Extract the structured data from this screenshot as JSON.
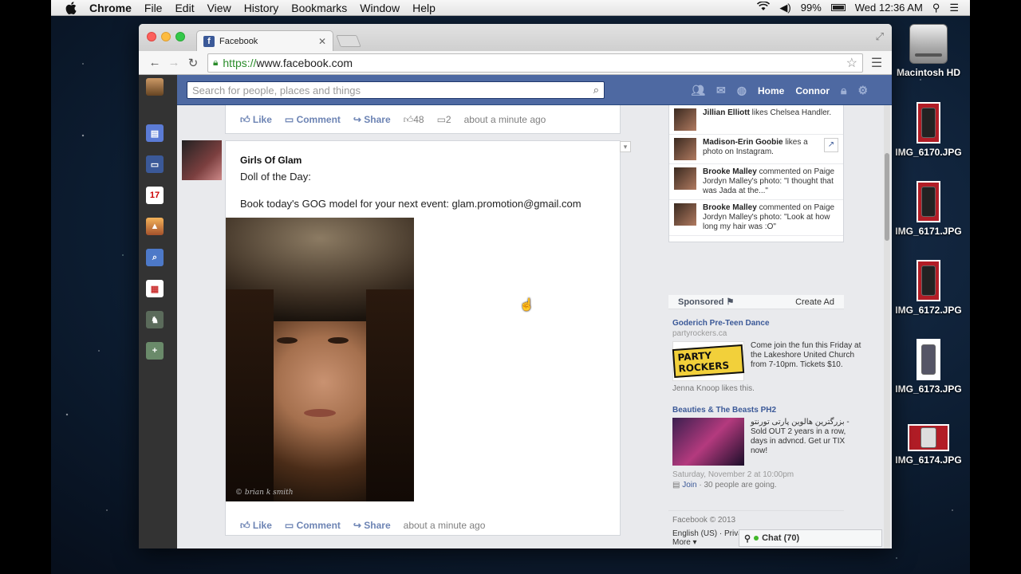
{
  "menubar": {
    "app": "Chrome",
    "items": [
      "File",
      "Edit",
      "View",
      "History",
      "Bookmarks",
      "Window",
      "Help"
    ],
    "battery": "99%",
    "clock": "Wed 12:36 AM"
  },
  "desktop": {
    "icons": [
      {
        "label": "Macintosh HD"
      },
      {
        "label": "IMG_6170.JPG"
      },
      {
        "label": "IMG_6171.JPG"
      },
      {
        "label": "IMG_6172.JPG"
      },
      {
        "label": "IMG_6173.JPG"
      },
      {
        "label": "IMG_6174.JPG"
      }
    ]
  },
  "browser": {
    "tab_title": "Facebook",
    "url_scheme": "https://",
    "url_host": "www.facebook.com"
  },
  "facebook": {
    "search_placeholder": "Search for people, places and things",
    "nav": {
      "home": "Home",
      "user": "Connor"
    },
    "rail_calendar_day": "17",
    "top_post_actions": {
      "like": "Like",
      "comment": "Comment",
      "share": "Share",
      "likes": "48",
      "comments": "2",
      "time": "about a minute ago"
    },
    "post": {
      "author": "Girls Of Glam",
      "line1": "Doll of the Day:",
      "line2": "Book today's GOG model for your next event: glam.promotion@gmail.com",
      "photo_credit": "© brian k smith",
      "actions": {
        "like": "Like",
        "comment": "Comment",
        "share": "Share",
        "time": "about a minute ago"
      }
    },
    "ticker": [
      {
        "name": "Jillian Elliott",
        "text": " likes Chelsea Handler."
      },
      {
        "name": "Madison-Erin Goobie",
        "text": " likes a photo on Instagram."
      },
      {
        "name": "Brooke Malley",
        "text": " commented on Paige Jordyn Malley's photo: \"I thought that was Jada at the...\""
      },
      {
        "name": "Brooke Malley",
        "text": " commented on Paige Jordyn Malley's photo: \"Look at how long my hair was :O\""
      }
    ],
    "sponsored": {
      "title": "Sponsored",
      "create_ad": "Create Ad"
    },
    "ads": [
      {
        "title": "Goderich Pre-Teen Dance",
        "url": "partyrockers.ca",
        "image_text": "PARTY ROCKERS",
        "body": "Come join the fun this Friday at the Lakeshore United Church from 7-10pm. Tickets $10.",
        "social": "Jenna Knoop likes this."
      },
      {
        "title": "Beauties & The Beasts PH2",
        "body": "بزرگترین هالوین پارتی تورنتو - Sold OUT 2 years in a row, days in advncd. Get ur TIX now!",
        "date": "Saturday, November 2 at 10:00pm",
        "join": "Join",
        "going": " · 30 people are going."
      }
    ],
    "footer": {
      "copyright": "Facebook © 2013",
      "links": "English (US) · Privacy · Terms · Cookies · More ▾"
    },
    "chat": "Chat (70)"
  }
}
